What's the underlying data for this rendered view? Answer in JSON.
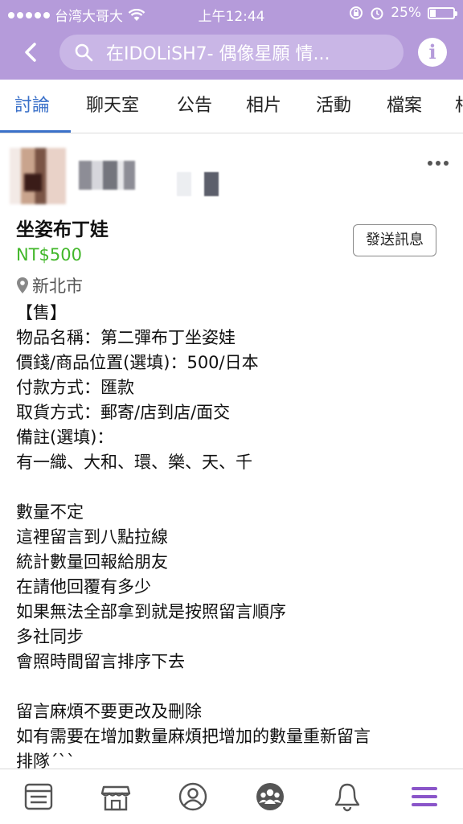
{
  "status_bar": {
    "carrier": "台湾大哥大",
    "time": "上午12:44",
    "battery": "25%",
    "battery_level": 0.25
  },
  "nav": {
    "search_text": "在IDOLiSH7- 偶像星願 情..."
  },
  "tabs": [
    {
      "label": "討論",
      "active": true
    },
    {
      "label": "聊天室",
      "active": false
    },
    {
      "label": "公告",
      "active": false
    },
    {
      "label": "相片",
      "active": false
    },
    {
      "label": "活動",
      "active": false
    },
    {
      "label": "檔案",
      "active": false
    },
    {
      "label": "相",
      "active": false
    }
  ],
  "post": {
    "title": "坐姿布丁娃",
    "price": "NT$500",
    "location": "新北市",
    "send_button": "發送訊息",
    "body_lines": [
      "【售】",
      "物品名稱：第二彈布丁坐姿娃",
      "價錢/商品位置(選填)：500/日本",
      "付款方式：匯款",
      "取貨方式：郵寄/店到店/面交",
      "備註(選填)：",
      "有一織、大和、環、樂、天、千",
      "",
      "數量不定",
      "這裡留言到八點拉線",
      "統計數量回報給朋友",
      "在請他回覆有多少",
      "如果無法全部拿到就是按照留言順序",
      "多社同步",
      "會照時間留言排序下去",
      "",
      "留言麻煩不要更改及刪除",
      "如有需要在增加數量麻煩把增加的數量重新留言",
      "排隊´ˋˋ"
    ]
  },
  "bottom_nav": [
    "news-feed-icon",
    "marketplace-icon",
    "profile-icon",
    "groups-icon",
    "notifications-icon",
    "menu-icon"
  ],
  "colors": {
    "header_bg": "#b59bda",
    "active_tab": "#3b71c9",
    "price": "#42b72a",
    "menu_active": "#8a55c9"
  }
}
